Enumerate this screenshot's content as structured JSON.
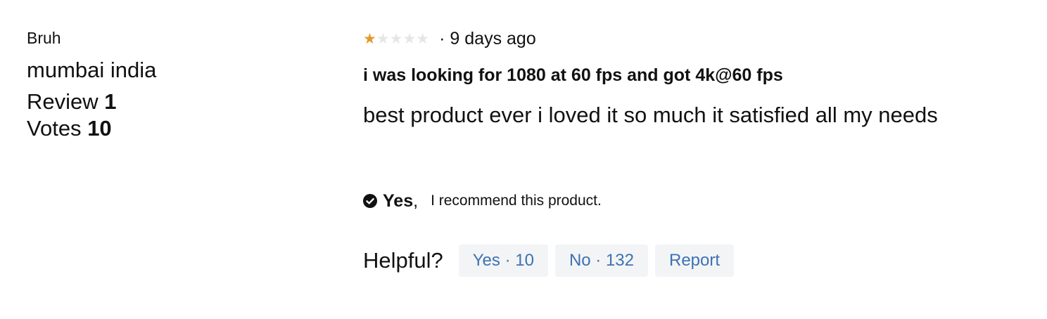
{
  "author": {
    "name": "Bruh",
    "location": "mumbai india",
    "review_label": "Review",
    "review_count": "1",
    "votes_label": "Votes",
    "votes_count": "10"
  },
  "review": {
    "rating": 1,
    "rating_max": 5,
    "star_glyphs": "★★★★★",
    "meta": "· 9 days ago",
    "title": "i was looking for 1080 at 60 fps and got 4k@60 fps",
    "body": "best product ever i loved it so much it satisfied all my needs",
    "recommend_icon": "check-circle-icon",
    "recommend_yes": "Yes",
    "recommend_comma": ",",
    "recommend_text": "I recommend this product."
  },
  "helpful": {
    "label": "Helpful?",
    "yes_button": "Yes · 10",
    "no_button": "No · 132",
    "report_button": "Report"
  },
  "colors": {
    "star_filled": "#e39a2b",
    "star_empty": "#e6e6e6",
    "link": "#3d72b4",
    "pill_bg": "#f3f4f5"
  }
}
